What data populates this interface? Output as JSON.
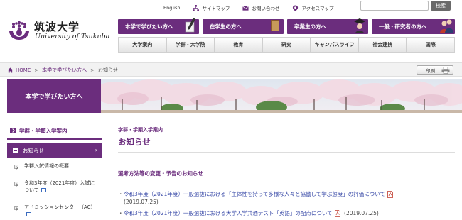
{
  "colors": {
    "brand_purple": "#6b2d7d",
    "link_blue": "#3a4ba8"
  },
  "header": {
    "logo_jp": "筑波大学",
    "logo_en": "University of Tsukuba",
    "utility": [
      {
        "label": "English",
        "icon": "none"
      },
      {
        "label": "サイトマップ",
        "icon": "sitemap-icon"
      },
      {
        "label": "お問い合わせ",
        "icon": "mail-icon"
      },
      {
        "label": "アクセスマップ",
        "icon": "map-pin-icon"
      }
    ],
    "search_value": "",
    "search_button": "検索",
    "audience": [
      {
        "label": "本学で学びたい方へ",
        "icon": "pen-icon"
      },
      {
        "label": "在学生の方へ",
        "icon": "book-icon"
      },
      {
        "label": "卒業生の方へ",
        "icon": "graduate-icon"
      },
      {
        "label": "一般・研究者の方へ",
        "icon": "people-icon"
      }
    ],
    "global_nav": [
      "大学案内",
      "学群・大学院",
      "教育",
      "研究",
      "キャンパスライフ",
      "社会連携",
      "国際"
    ]
  },
  "breadcrumb": {
    "home": "HOME",
    "items": [
      "本学で学びたい方へ",
      "お知らせ"
    ],
    "print_label": "印刷"
  },
  "banner": {
    "title": "本学で学びたい方へ"
  },
  "sidebar": {
    "heading": "学群・学類入学案内",
    "active": "お知らせ",
    "items": [
      {
        "label": "学群入試情報の概要",
        "external": false
      },
      {
        "label": "令和3年度（2021年度）入試について",
        "external": true
      },
      {
        "label": "アドミッションセンター（AC）",
        "external": true
      }
    ]
  },
  "main": {
    "category": "学群・学類入学案内",
    "title": "お知らせ",
    "section_title": "選考方法等の変更・予告のお知らせ",
    "notices": [
      {
        "text": "令和3年度（2021年度）一般選抜における「主体性を持って多様な人々と協働して学ぶ態度」の評価について",
        "date": "(2019.07.25)"
      },
      {
        "text": "令和3年度（2021年度）一般選抜における大学入学共通テスト「英語」の配点について",
        "date": "(2019.07.25)"
      }
    ]
  }
}
